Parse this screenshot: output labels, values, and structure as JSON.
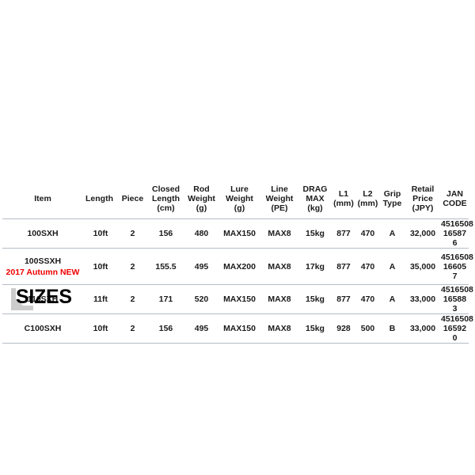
{
  "section": {
    "title": "SIZES",
    "accent_gray": "#cccccc",
    "rule_color": "#b4bcc6",
    "highlight_color": "#ee0000"
  },
  "table": {
    "headers": [
      {
        "lines": [
          "Item"
        ]
      },
      {
        "lines": [
          "Length"
        ]
      },
      {
        "lines": [
          "Piece"
        ]
      },
      {
        "lines": [
          "Closed",
          "Length",
          "(cm)"
        ]
      },
      {
        "lines": [
          "Rod",
          "Weight",
          "(g)"
        ]
      },
      {
        "lines": [
          "Lure",
          "Weight",
          "(g)"
        ]
      },
      {
        "lines": [
          "Line",
          "Weight",
          "(PE)"
        ]
      },
      {
        "lines": [
          "DRAG",
          "MAX",
          "(kg)"
        ]
      },
      {
        "lines": [
          "L1",
          "(mm)"
        ]
      },
      {
        "lines": [
          "L2",
          "(mm)"
        ]
      },
      {
        "lines": [
          "Grip",
          "Type"
        ]
      },
      {
        "lines": [
          "Retail",
          "Price",
          "(JPY)"
        ]
      },
      {
        "lines": [
          "JAN CODE"
        ]
      }
    ],
    "rows": [
      {
        "item": "100SXH",
        "badge": "",
        "length": "10ft",
        "piece": "2",
        "closed_length": "156",
        "rod_weight": "480",
        "lure_weight": "MAX150",
        "line_weight": "MAX8",
        "drag_max": "15kg",
        "l1": "877",
        "l2": "470",
        "grip_type": "A",
        "retail_price": "32,000",
        "jan_code": "4516508 16587 6"
      },
      {
        "item": "100SSXH",
        "badge": "2017 Autumn NEW",
        "length": "10ft",
        "piece": "2",
        "closed_length": "155.5",
        "rod_weight": "495",
        "lure_weight": "MAX200",
        "line_weight": "MAX8",
        "drag_max": "17kg",
        "l1": "877",
        "l2": "470",
        "grip_type": "A",
        "retail_price": "35,000",
        "jan_code": "4516508 16605 7"
      },
      {
        "item": "110SXH",
        "badge": "",
        "length": "11ft",
        "piece": "2",
        "closed_length": "171",
        "rod_weight": "520",
        "lure_weight": "MAX150",
        "line_weight": "MAX8",
        "drag_max": "15kg",
        "l1": "877",
        "l2": "470",
        "grip_type": "A",
        "retail_price": "33,000",
        "jan_code": "4516508 16588 3"
      },
      {
        "item": "C100SXH",
        "badge": "",
        "length": "10ft",
        "piece": "2",
        "closed_length": "156",
        "rod_weight": "495",
        "lure_weight": "MAX150",
        "line_weight": "MAX8",
        "drag_max": "15kg",
        "l1": "928",
        "l2": "500",
        "grip_type": "B",
        "retail_price": "33,000",
        "jan_code": "4516508 16592 0"
      }
    ]
  },
  "icons": {
    "corner_arrow": "corner-arrow-icon"
  }
}
